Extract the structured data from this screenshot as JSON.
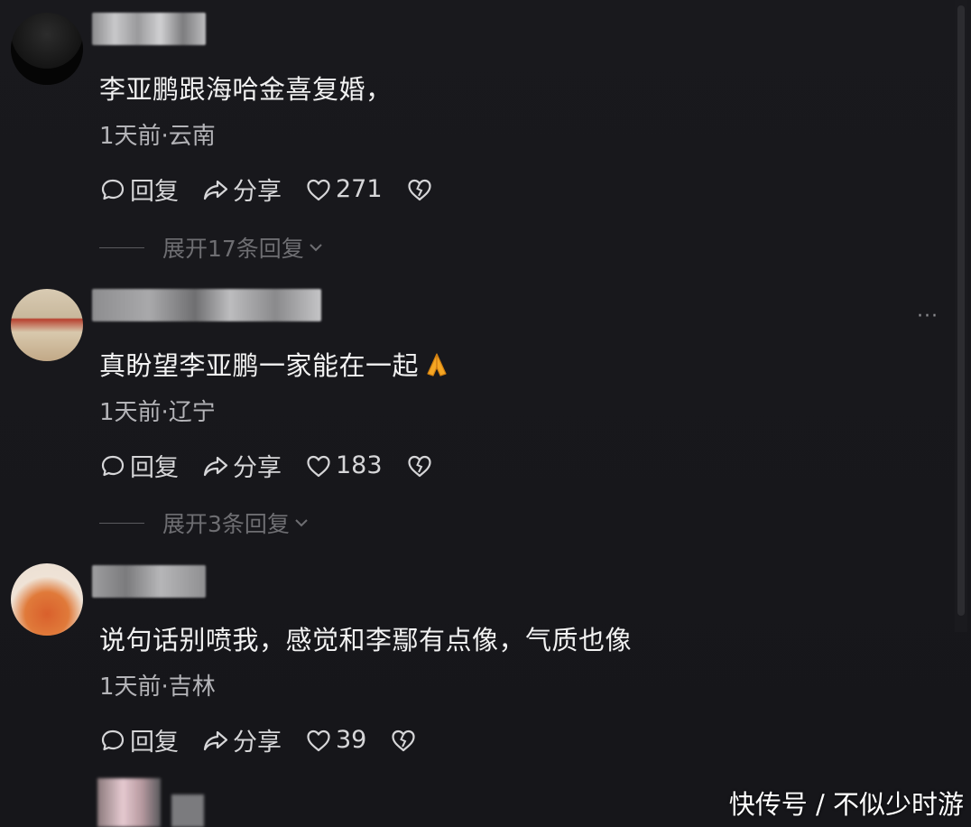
{
  "comments": [
    {
      "content": "李亚鹏跟海哈金喜复婚，",
      "meta": "1天前·云南",
      "reply_label": "回复",
      "share_label": "分享",
      "likes": "271",
      "expand_label": "展开17条回复"
    },
    {
      "content": "真盼望李亚鹏一家能在一起",
      "meta": "1天前·辽宁",
      "reply_label": "回复",
      "share_label": "分享",
      "likes": "183",
      "expand_label": "展开3条回复"
    },
    {
      "content": "说句话别喷我，感觉和李鄢有点像，气质也像",
      "meta": "1天前·吉林",
      "reply_label": "回复",
      "share_label": "分享",
      "likes": "39"
    }
  ],
  "more_label": "···",
  "watermark": "快传号 / 不似少时游",
  "icons": {
    "reply": "comment-bubble-icon",
    "share": "share-arrow-icon",
    "like": "heart-icon",
    "dislike": "broken-heart-icon",
    "emoji": "folded-hands-emoji",
    "expand": "chevron-down-icon"
  },
  "colors": {
    "background": "#16161a",
    "text": "#f2f2f2",
    "meta": "#b4b4b8",
    "muted": "#6e6e72"
  }
}
